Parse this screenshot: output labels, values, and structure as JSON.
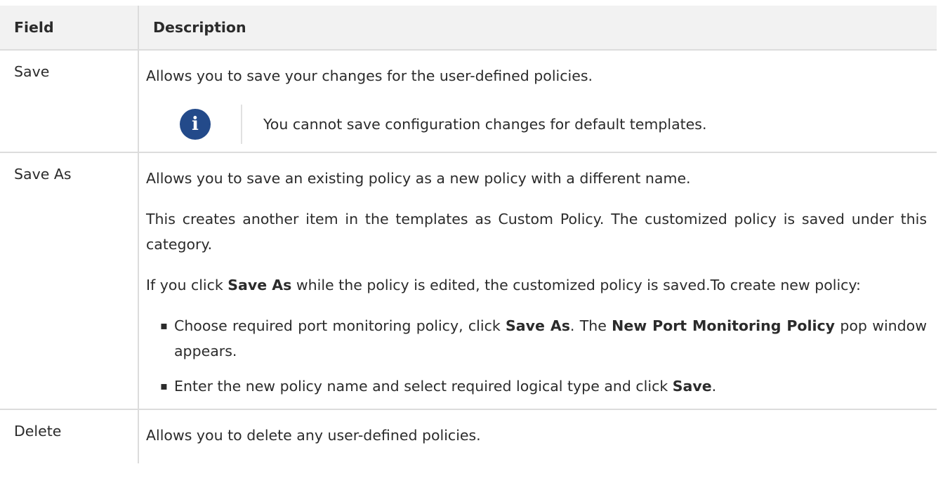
{
  "table": {
    "headers": {
      "field": "Field",
      "description": "Description"
    },
    "rows": [
      {
        "field": "Save",
        "description": "Allows you to save your changes for the user-defined policies.",
        "note": {
          "icon": "info-icon",
          "icon_glyph": "i",
          "text": "You cannot save configuration changes for default templates."
        }
      },
      {
        "field": "Save As",
        "paragraph_1": "Allows you to save an existing policy as a new policy with a different name.",
        "paragraph_2": "This creates another item in the templates as Custom Policy. The customized policy is saved under this category.",
        "paragraph_3": {
          "text_before": "If you click ",
          "bold": "Save As",
          "text_after": " while the policy is edited, the customized policy is saved.To create new policy:"
        },
        "bullets": [
          {
            "text_1": "Choose required port monitoring policy, click ",
            "bold_1": "Save As",
            "text_2": ". The ",
            "bold_2": "New Port Monitoring Policy",
            "text_3": " pop window appears."
          },
          {
            "text_1": "Enter the new policy name and select required logical type and click ",
            "bold_1": "Save",
            "text_2": "."
          }
        ]
      },
      {
        "field": "Delete",
        "description": "Allows you to delete any user-defined policies."
      }
    ]
  },
  "colors": {
    "header_background": "#f2f2f2",
    "border": "#dcdcdc",
    "info_icon_background": "#234a8a",
    "text": "#2b2b2b"
  }
}
